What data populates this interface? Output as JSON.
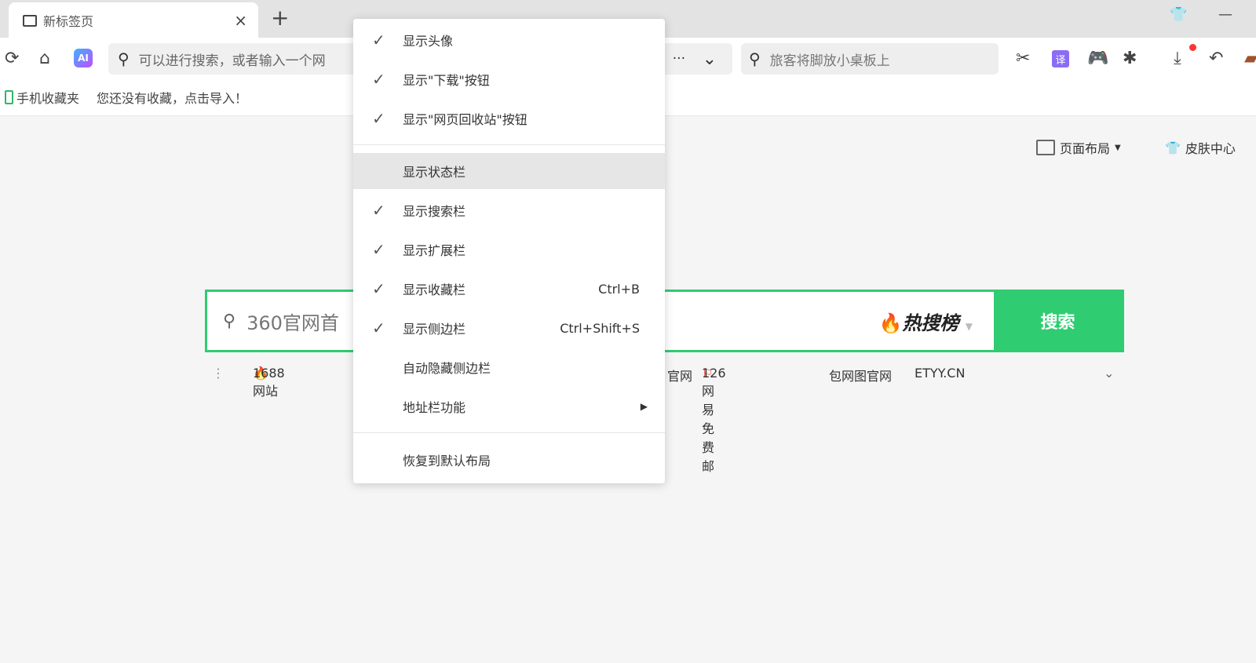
{
  "tab": {
    "title": "新标签页",
    "close": "×",
    "new": "+"
  },
  "window": {
    "skin": "👕",
    "minimize": "—"
  },
  "toolbar": {
    "address_placeholder": "可以进行搜索，或者输入一个网",
    "more": "···",
    "dropdown": "⌄",
    "search_placeholder": "旅客将脚放小桌板上",
    "translate": "译"
  },
  "bookmarks": {
    "mobile": "手机收藏夹",
    "empty": "您还没有收藏，点击导入！"
  },
  "page": {
    "layout": "页面布局",
    "skin": "皮肤中心",
    "search_placeholder": "360官网首",
    "hot": "热搜榜",
    "search_btn": "搜索",
    "links": [
      "1688网站",
      "官网",
      "126网易免费邮",
      "包网图官网",
      "ETYY.CN"
    ]
  },
  "menu": {
    "items": [
      {
        "label": "显示头像",
        "checked": true
      },
      {
        "label": "显示\"下载\"按钮",
        "checked": true
      },
      {
        "label": "显示\"网页回收站\"按钮",
        "checked": true
      },
      {
        "label": "显示状态栏",
        "checked": false
      },
      {
        "label": "显示搜索栏",
        "checked": true
      },
      {
        "label": "显示扩展栏",
        "checked": true
      },
      {
        "label": "显示收藏栏",
        "checked": true,
        "shortcut": "Ctrl+B"
      },
      {
        "label": "显示侧边栏",
        "checked": true,
        "shortcut": "Ctrl+Shift+S"
      },
      {
        "label": "自动隐藏侧边栏",
        "checked": false
      },
      {
        "label": "地址栏功能",
        "checked": false,
        "submenu": "▶"
      },
      {
        "label": "恢复到默认布局",
        "checked": false
      }
    ],
    "check": "✓"
  }
}
